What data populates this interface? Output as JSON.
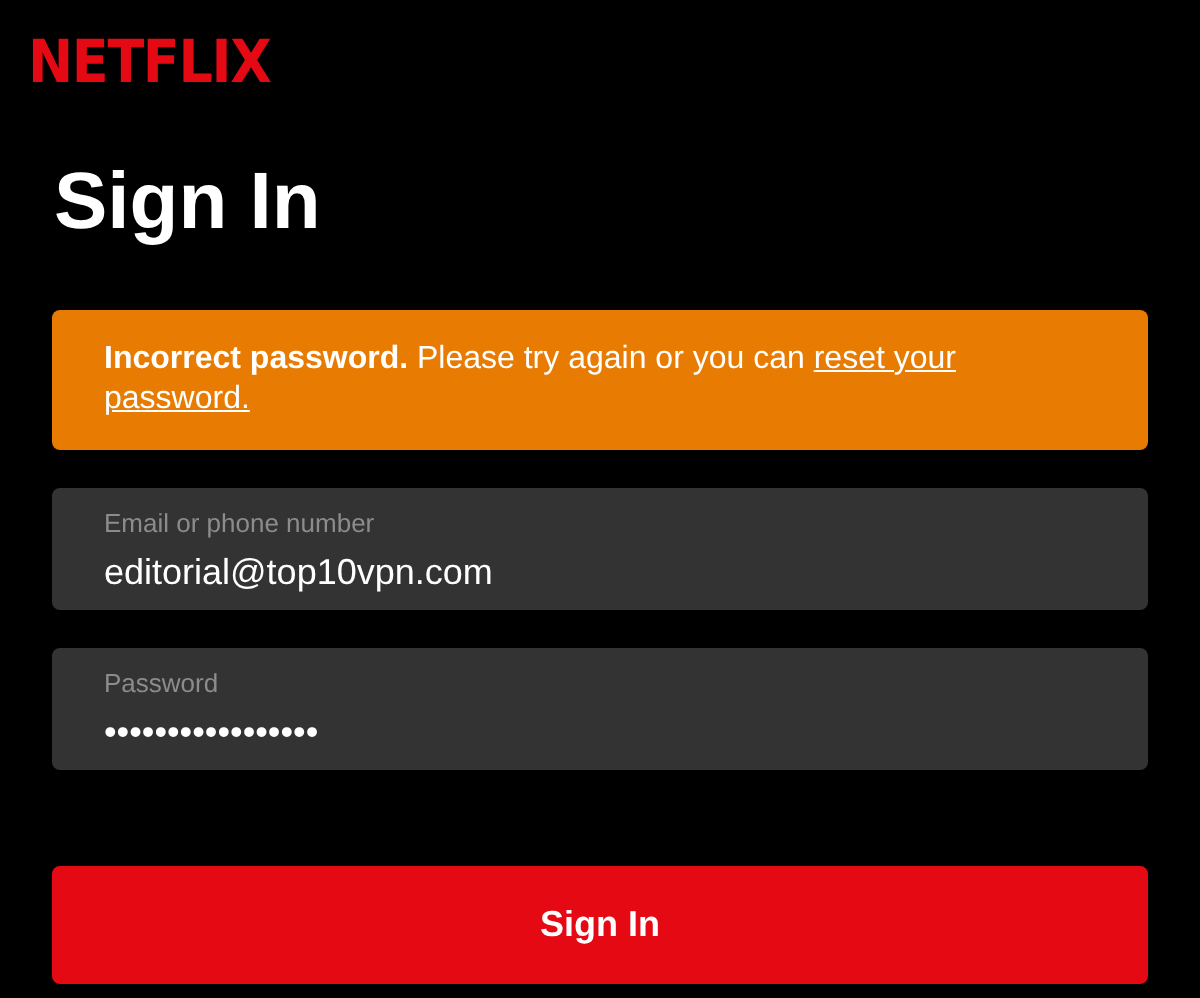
{
  "logo": "NETFLIX",
  "title": "Sign In",
  "alert": {
    "text": "**Incorrect password.** Please try again or you can",
    "link_lines": [
      "reset your",
      "password."
    ]
  },
  "fields": [
    {
      "label": "Email or phone number",
      "value": "editorial@top10vpn.com"
    },
    {
      "label": "Password",
      "value": "•••••••••••••••••"
    }
  ],
  "submit": "Sign In"
}
